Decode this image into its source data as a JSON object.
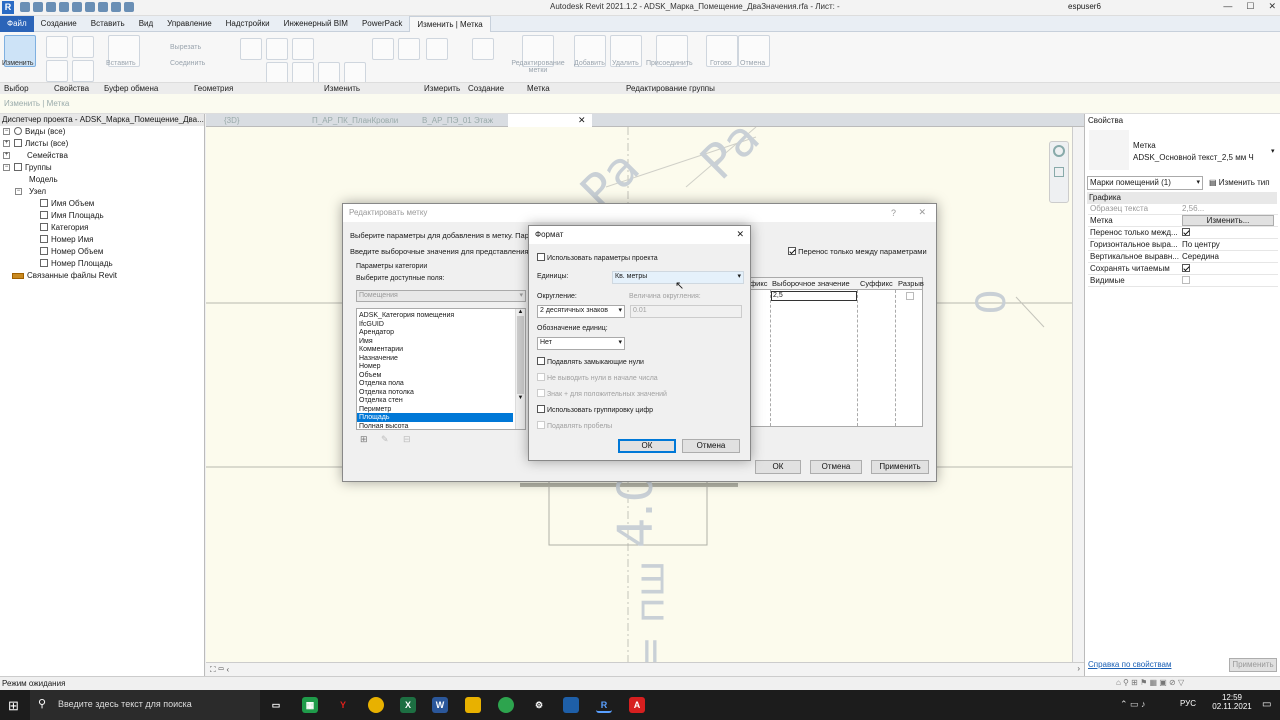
{
  "app": {
    "title": "Autodesk Revit 2021.1.2 - ADSK_Марка_Помещение_ДваЗначения.rfa - Лист: -",
    "user": "espuser6",
    "logo": "R"
  },
  "ribbon_tabs": [
    "Файл",
    "Создание",
    "Вставить",
    "Вид",
    "Управление",
    "Надстройки",
    "Инженерный BIM",
    "PowerPack",
    "Изменить | Метка"
  ],
  "ribbon": {
    "modify_btn": "Изменить",
    "paste_btn": "Вставить",
    "cut_btn": "Вырезать",
    "join_btn": "Соединить",
    "edit_label_btn": "Редактирование метки",
    "add_btn": "Добавить",
    "remove_btn": "Удалить",
    "attach_btn": "Присоединить",
    "finish_btn": "Готово",
    "cancel_btn": "Отмена",
    "groups": [
      "Выбор",
      "Свойства",
      "Буфер обмена",
      "Геометрия",
      "Изменить",
      "Измерить",
      "Создание",
      "Метка",
      "Редактирование группы"
    ]
  },
  "options_bar": "Изменить | Метка",
  "browser": {
    "header": "Диспетчер проекта - ADSK_Марка_Помещение_Два...",
    "nodes": [
      {
        "label": "Виды (все)"
      },
      {
        "label": "Листы (все)"
      },
      {
        "label": "Семейства"
      },
      {
        "label": "Группы"
      },
      {
        "label": "Модель"
      },
      {
        "label": "Узел"
      },
      {
        "label": "Имя Объем"
      },
      {
        "label": "Имя Площадь"
      },
      {
        "label": "Категория"
      },
      {
        "label": "Номер Имя"
      },
      {
        "label": "Номер Объем"
      },
      {
        "label": "Номер Площадь"
      },
      {
        "label": "Связанные файлы Revit"
      }
    ]
  },
  "doc_tabs": [
    "{3D}",
    "П_АР_ПК_ПланКровли",
    "В_АР_ПЭ_01 Этаж",
    ""
  ],
  "canvas_text": {
    "frag1": "Ра",
    "frag2": "Ра",
    "zero": "0",
    "four": "4.0",
    "eq": "= пш"
  },
  "properties": {
    "header": "Свойства",
    "family": "Метка",
    "type": "ADSK_Основной текст_2,5 мм Ч",
    "filter": "Марки помещений (1)",
    "edit_type": "Изменить тип",
    "section": "Графика",
    "rows": [
      {
        "k": "Образец текста",
        "v": "2,56..."
      },
      {
        "k": "Метка",
        "v": "Изменить..."
      },
      {
        "k": "Перенос только межд...",
        "v": ""
      },
      {
        "k": "Горизонтальное выра...",
        "v": "По центру"
      },
      {
        "k": "Вертикальное выравн...",
        "v": "Середина"
      },
      {
        "k": "Сохранять читаемым",
        "v": ""
      },
      {
        "k": "Видимые",
        "v": ""
      }
    ],
    "help_link": "Справка по свойствам",
    "apply": "Применить"
  },
  "status": {
    "text": "Режим ожидания"
  },
  "edit_label_dialog": {
    "title": "Редактировать метку",
    "help": "?",
    "close": "✕",
    "instruction1": "Выберите параметры для добавления в метку. Пара",
    "instruction2": "Введите выборочные значения для представления...",
    "wrap_checkbox": "Перенос только между параметрами",
    "category_params": "Параметры категории",
    "select_fields": "Выберите доступные поля:",
    "category": "Помещения",
    "fields": [
      "ADSK_Категория помещения",
      "IfcGUID",
      "Арендатор",
      "Имя",
      "Комментарии",
      "Назначение",
      "Номер",
      "Объем",
      "Отделка пола",
      "Отделка потолка",
      "Отделка стен",
      "Периметр",
      "Площадь",
      "Полная высота"
    ],
    "selected_field": "Площадь",
    "columns": [
      "фикс",
      "Выборочное значение",
      "Суффикс",
      "Разрыв"
    ],
    "sample_value": "2,5",
    "ok": "ОК",
    "cancel": "Отмена",
    "apply": "Применить"
  },
  "format_dialog": {
    "title": "Формат",
    "close": "✕",
    "use_project": "Использовать параметры проекта",
    "units_label": "Единицы:",
    "units_value": "Кв. метры",
    "rounding_label": "Округление:",
    "rounding_value": "2 десятичных знаков",
    "increment_label": "Величина округления:",
    "increment_value": "0.01",
    "symbol_label": "Обозначение единиц:",
    "symbol_value": "Нет",
    "suppress_trailing": "Подавлять замыкающие нули",
    "suppress_leading": "Не выводить нули в начале числа",
    "plus_prefix": "Знак + для положительных значений",
    "digit_grouping": "Использовать группировку цифр",
    "suppress_spaces": "Подавлять пробелы",
    "ok": "ОК",
    "cancel": "Отмена"
  },
  "taskbar": {
    "search_placeholder": "Введите здесь текст для поиска",
    "lang": "РУС",
    "time": "12:59",
    "date": "02.11.2021"
  }
}
